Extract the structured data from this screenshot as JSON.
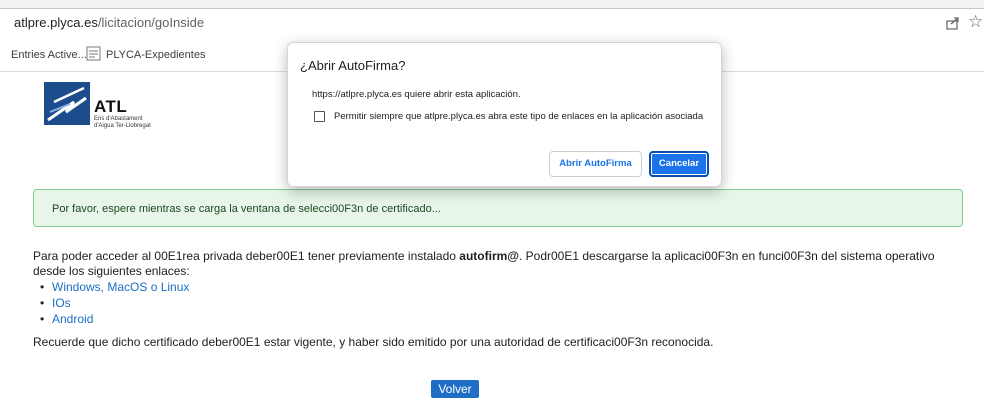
{
  "browser": {
    "url_host": "atlpre.plyca.es",
    "url_path": "/licitacion/goInside",
    "bookmarks": [
      "Entries Active...",
      "PLYCA-Expedientes"
    ],
    "icons": [
      "share-icon",
      "star-icon",
      "bookmark-page-icon"
    ]
  },
  "logo": {
    "title": "ATL",
    "subtitle_line1": "Ens d'Abastament",
    "subtitle_line2": "d'Aigua Ter-Llobregat",
    "color": "#1d4c8c"
  },
  "alert": {
    "text": "Por favor, espere mientras se carga la ventana de selecci00F3n de certificado..."
  },
  "content": {
    "p1_before": "Para poder acceder al 00E1rea privada deber00E1 tener previamente instalado ",
    "p1_bold": "autofirm@",
    "p1_after": ". Podr00E1 descargarse la aplicaci00F3n en funci00F3n del sistema operativo desde los siguientes enlaces:",
    "links": [
      "Windows, MacOS o Linux",
      "IOs",
      "Android"
    ],
    "p2": "Recuerde que dicho certificado deber00E1 estar vigente, y haber sido emitido por una autoridad de certificaci00F3n reconocida.",
    "volver_label": "Volver"
  },
  "dialog": {
    "title": "¿Abrir AutoFirma?",
    "message": "https://atlpre.plyca.es quiere abrir esta aplicación.",
    "checkbox_label": "Permitir siempre que atlpre.plyca.es abra este tipo de enlaces en la aplicación asociada",
    "checkbox_checked": false,
    "open_label": "Abrir AutoFirma",
    "cancel_label": "Cancelar",
    "accent": "#1a73e8"
  }
}
